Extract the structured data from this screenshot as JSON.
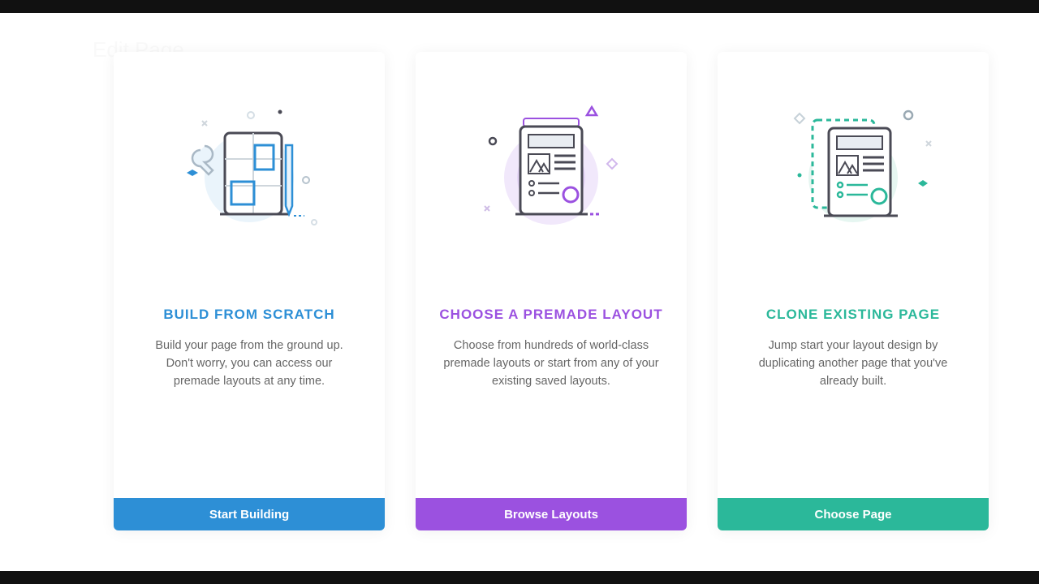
{
  "background": {
    "title": "Edit Page"
  },
  "cards": [
    {
      "title": "BUILD FROM SCRATCH",
      "desc": "Build your page from the ground up. Don't worry, you can access our premade layouts at any time.",
      "button": "Start Building"
    },
    {
      "title": "CHOOSE A PREMADE LAYOUT",
      "desc": "Choose from hundreds of world-class premade layouts or start from any of your existing saved layouts.",
      "button": "Browse Layouts"
    },
    {
      "title": "CLONE EXISTING PAGE",
      "desc": "Jump start your layout design by duplicating another page that you've already built.",
      "button": "Choose Page"
    }
  ],
  "colors": {
    "blue": "#2d8fd6",
    "purple": "#9b51e0",
    "teal": "#2bb89a"
  }
}
